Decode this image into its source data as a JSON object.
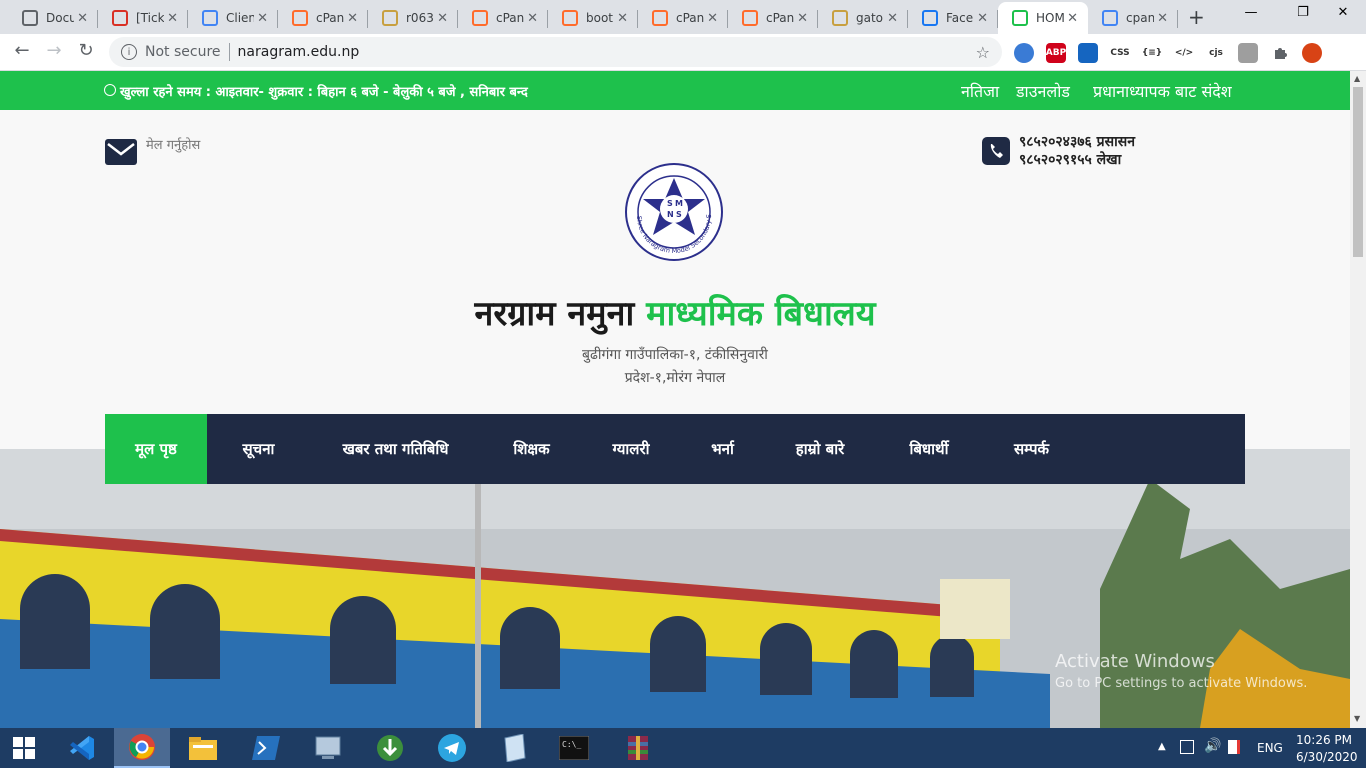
{
  "browser": {
    "tabs": [
      {
        "title": "Docu",
        "icon": "document-icon",
        "color": "#5f6368"
      },
      {
        "title": "[Tick",
        "icon": "gmail-icon",
        "color": "#d93025"
      },
      {
        "title": "Clien",
        "icon": "client-icon",
        "color": "#4285f4"
      },
      {
        "title": "cPan",
        "icon": "cpanel-icon",
        "color": "#ff6c2c"
      },
      {
        "title": "r063",
        "icon": "ship-icon",
        "color": "#c8a040"
      },
      {
        "title": "cPan",
        "icon": "cpanel-icon",
        "color": "#ff6c2c"
      },
      {
        "title": "boot",
        "icon": "cpanel-icon",
        "color": "#ff6c2c"
      },
      {
        "title": "cPan",
        "icon": "cpanel-icon",
        "color": "#ff6c2c"
      },
      {
        "title": "cPan",
        "icon": "cpanel-icon",
        "color": "#ff6c2c"
      },
      {
        "title": "gato",
        "icon": "ship-icon",
        "color": "#c8a040"
      },
      {
        "title": "Facel",
        "icon": "facebook-icon",
        "color": "#1877f2"
      },
      {
        "title": "HOM",
        "icon": "book-icon",
        "color": "#1ec14c",
        "active": true
      },
      {
        "title": "cpan",
        "icon": "google-icon",
        "color": "#4285f4"
      }
    ],
    "not_secure": "Not secure",
    "url": "naragram.edu.np",
    "extensions": [
      {
        "icon": "globe-icon",
        "label": "",
        "bg": "#3a7bd5"
      },
      {
        "icon": "adblock-icon",
        "label": "ABP",
        "bg": "#d0021b"
      },
      {
        "icon": "extension-icon",
        "label": "",
        "bg": "#1565c0"
      },
      {
        "icon": "css-icon",
        "label": "CSS",
        "bg": "#ffffff"
      },
      {
        "icon": "json-icon",
        "label": "{≡}",
        "bg": "#ffffff"
      },
      {
        "icon": "code-icon",
        "label": "</>",
        "bg": "#ffffff"
      },
      {
        "icon": "cjs-icon",
        "label": "cjs",
        "bg": "#ffffff"
      },
      {
        "icon": "profile-ext-icon",
        "label": "",
        "bg": "#9e9e9e"
      },
      {
        "icon": "puzzle-icon",
        "label": "",
        "bg": "#ffffff"
      },
      {
        "icon": "avatar-icon",
        "label": "",
        "bg": "#d84315"
      }
    ]
  },
  "site": {
    "hours": "खुल्ला रहने समय : आइतवार- शुक्रवार : बिहान ६ बजे - बेलुकी ५ बजे , सनिबार बन्द",
    "top_links": [
      "नतिजा",
      "डाउनलोड",
      "प्रधानाध्यापक बाट संदेश"
    ],
    "mail_label": "मेल गर्नुहोस",
    "phone_admin": "९८५२०२४३७६ प्रसासन",
    "phone_account": "९८५२०२९१५५ लेखा",
    "school_name_part1": "नरग्राम नमुना",
    "school_name_part2": "माध्यमिक बिधालय",
    "address_line1": "बुढीगंगा गाउँपालिका-१, टंकीसिनुवारी",
    "address_line2": "प्रदेश-१,मोरंग नेपाल",
    "logo_letters": "SMNS",
    "logo_text_arc": "Shree Naragram Model Secondary School",
    "menu": [
      "मूल पृष्ठ",
      "सूचना",
      "खबर तथा गतिबिधि",
      "शिक्षक",
      "ग्यालरी",
      "भर्ना",
      "हाम्रो बारे",
      "बिधार्थी",
      "सम्पर्क"
    ],
    "menu_active_index": 0,
    "colors": {
      "green": "#1ec14c",
      "navy": "#1f2a44"
    }
  },
  "watermark": {
    "title": "Activate Windows",
    "subtitle": "Go to PC settings to activate Windows."
  },
  "taskbar": {
    "lang": "ENG",
    "time": "10:26 PM",
    "date": "6/30/2020"
  }
}
